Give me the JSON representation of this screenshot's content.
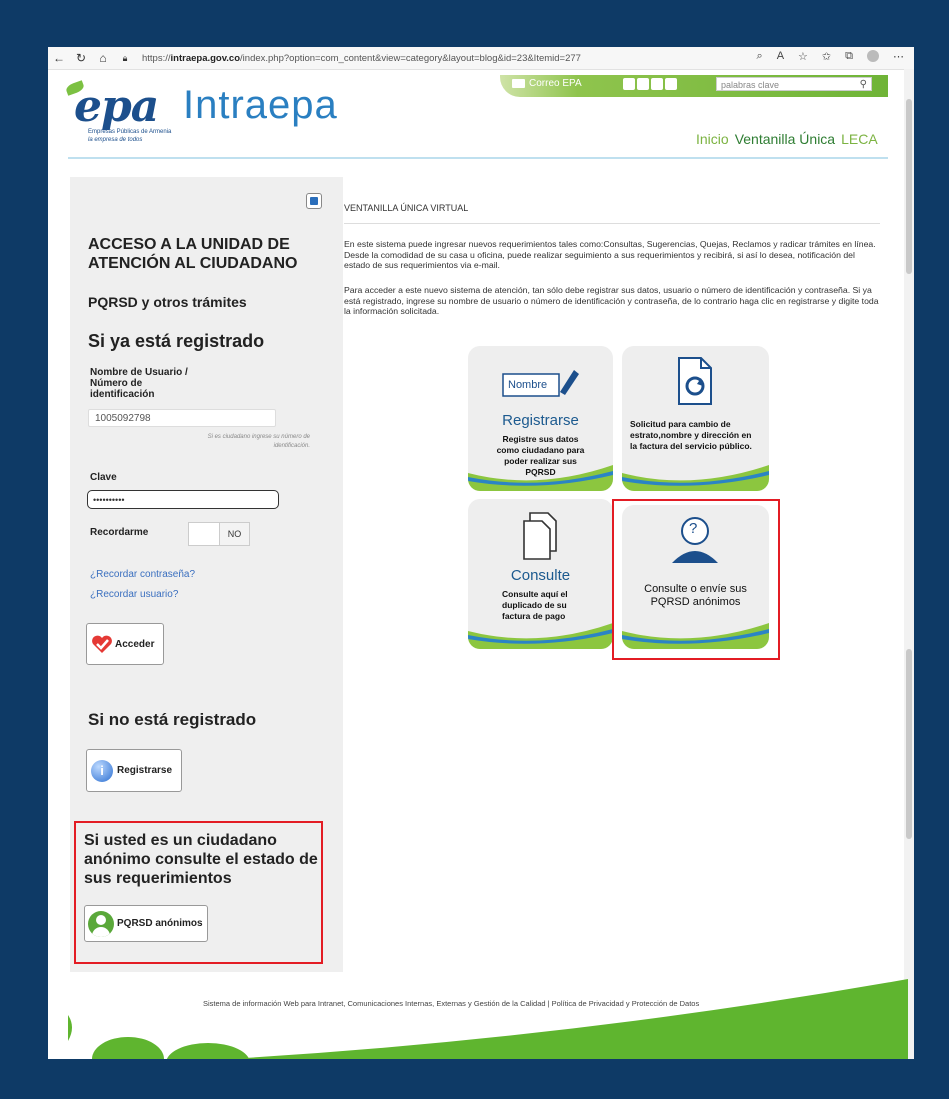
{
  "browser": {
    "url_prefix": "https://",
    "url_host": "intraepa.gov.co",
    "url_rest": "/index.php?option=com_content&view=category&layout=blog&id=23&Itemid=277"
  },
  "header": {
    "logo_text": "epa",
    "logo_sub": "Empresas Públicas de Armenia",
    "logo_tagline": "la empresa de todos",
    "brand": "Intraepa",
    "correo_label": "Correo EPA",
    "search_placeholder": "palabras clave",
    "nav": [
      "Inicio",
      "Ventanilla Única",
      "LECA"
    ]
  },
  "sidebar": {
    "heading": "ACCESO A LA UNIDAD DE ATENCIÓN AL CIUDADANO",
    "subheading": "PQRSD y otros trámites",
    "registered_heading": "Si ya está registrado",
    "user_label": "Nombre de Usuario / Número de identificación",
    "user_value": "1005092798",
    "user_hint": "Si es ciudadano ingrese su número de identificación.",
    "password_label": "Clave",
    "password_value": "••••••••••",
    "remember_label": "Recordarme",
    "remember_value": "NO",
    "forgot_password": "¿Recordar contraseña?",
    "forgot_user": "¿Recordar usuario?",
    "login_button": "Acceder",
    "not_registered_heading": "Si no está registrado",
    "register_button": "Registrarse",
    "anon_heading": "Si usted es un ciudadano anónimo consulte el estado de sus requerimientos",
    "anon_button": "PQRSD anónimos"
  },
  "content": {
    "title": "VENTANILLA ÚNICA VIRTUAL",
    "para1": "En este sistema puede ingresar nuevos requerimientos tales como:Consultas, Sugerencias, Quejas, Reclamos y radicar trámites en línea. Desde la comodidad de su casa u oficina, puede realizar seguimiento a sus requerimientos y recibirá, si así lo desea, notificación del estado de sus requerimientos via e-mail.",
    "para2": "Para acceder a este nuevo sistema de atención, tan sólo debe registrar sus datos, usuario o número de identificación y contraseña. Si ya está registrado, ingrese su nombre de usuario o número de identificación y contraseña, de lo contrario haga clic en registrarse y digite toda la información solicitada.",
    "cards": [
      {
        "icon_text": "Nombre",
        "title": "Registrarse",
        "desc": "Registre sus datos como ciudadano para poder realizar sus PQRSD"
      },
      {
        "title": "",
        "desc": "Solicitud para cambio de estrato,nombre y dirección en la factura del servicio público."
      },
      {
        "title": "Consulte",
        "desc": "Consulte aquí el duplicado de su factura de pago"
      },
      {
        "icon_text": "?",
        "title": "",
        "desc": "Consulte o envíe sus PQRSD anónimos"
      }
    ]
  },
  "footer": {
    "text": "Sistema de información Web para Intranet, Comunicaciones Internas, Externas y Gestión de la Calidad | Política de Privacidad y Protección de Datos"
  }
}
